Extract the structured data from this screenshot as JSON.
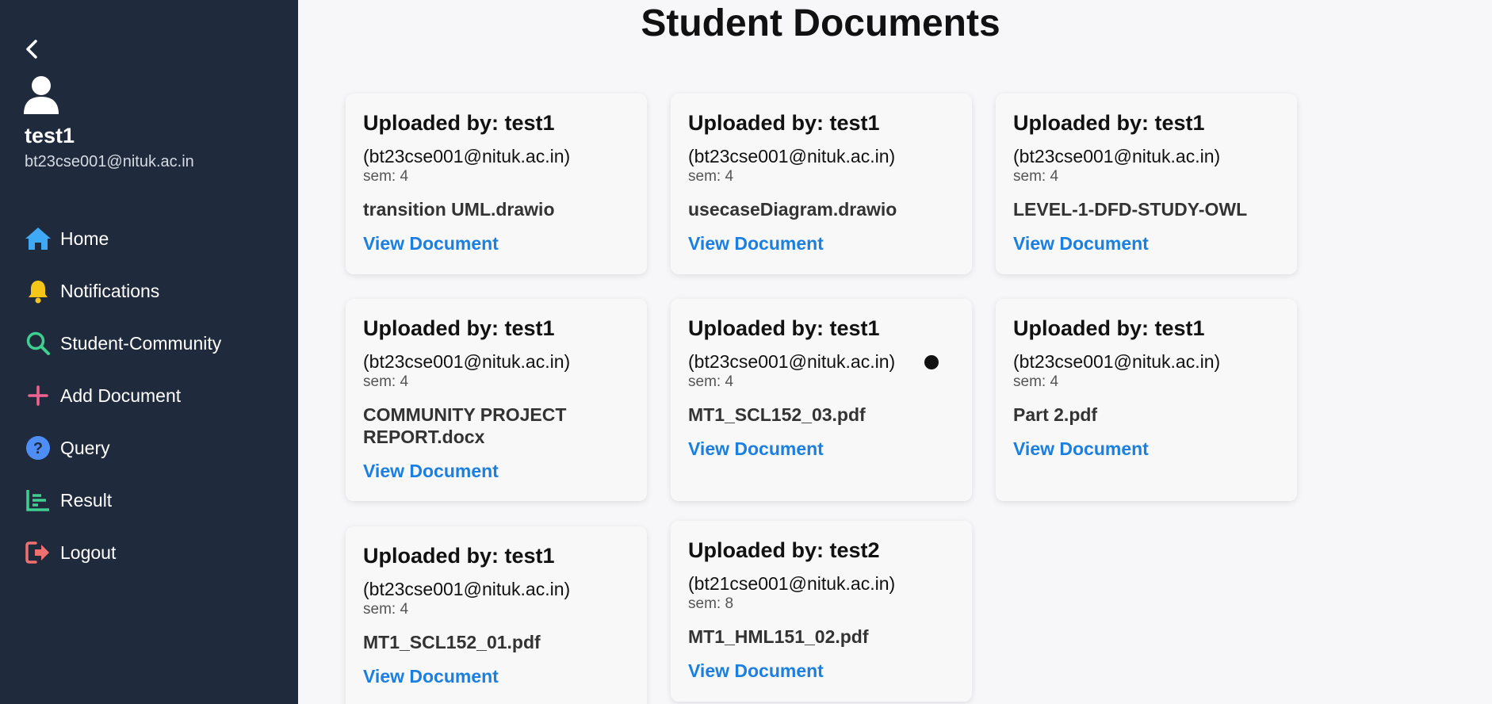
{
  "sidebar": {
    "user_name": "test1",
    "user_email": "bt23cse001@nituk.ac.in",
    "items": [
      {
        "label": "Home",
        "icon": "home-icon",
        "color": "#3fa9f5"
      },
      {
        "label": "Notifications",
        "icon": "bell-icon",
        "color": "#f5c518"
      },
      {
        "label": "Student-Community",
        "icon": "search-icon",
        "color": "#3fd08f"
      },
      {
        "label": "Add Document",
        "icon": "plus-icon",
        "color": "#f06292"
      },
      {
        "label": "Query",
        "icon": "question-icon",
        "color": "#4f8ef7"
      },
      {
        "label": "Result",
        "icon": "chart-icon",
        "color": "#3fd08f"
      },
      {
        "label": "Logout",
        "icon": "logout-icon",
        "color": "#f07070"
      }
    ]
  },
  "main": {
    "title": "Student Documents",
    "link_color": "#1a7fe0",
    "cards": [
      {
        "uploader": "Uploaded by: test1",
        "email": "(bt23cse001@nituk.ac.in)",
        "sem": "sem: 4",
        "file": "transition UML.drawio",
        "link": "View Document"
      },
      {
        "uploader": "Uploaded by: test1",
        "email": "(bt23cse001@nituk.ac.in)",
        "sem": "sem: 4",
        "file": "usecaseDiagram.drawio",
        "link": "View Document"
      },
      {
        "uploader": "Uploaded by: test1",
        "email": "(bt23cse001@nituk.ac.in)",
        "sem": "sem: 4",
        "file": "LEVEL-1-DFD-STUDY-OWL",
        "link": "View Document"
      },
      {
        "uploader": "Uploaded by: test1",
        "email": "(bt23cse001@nituk.ac.in)",
        "sem": "sem: 4",
        "file": "COMMUNITY PROJECT REPORT.docx",
        "link": "View Document"
      },
      {
        "uploader": "Uploaded by: test1",
        "email": "(bt23cse001@nituk.ac.in)",
        "sem": "sem: 4",
        "file": "MT1_SCL152_03.pdf",
        "link": "View Document"
      },
      {
        "uploader": "Uploaded by: test1",
        "email": "(bt23cse001@nituk.ac.in)",
        "sem": "sem: 4",
        "file": "Part 2.pdf",
        "link": "View Document"
      },
      {
        "uploader": "Uploaded by: test1",
        "email": "(bt23cse001@nituk.ac.in)",
        "sem": "sem: 4",
        "file": "MT1_SCL152_01.pdf",
        "link": "View Document"
      },
      {
        "uploader": "Uploaded by: test2",
        "email": "(bt21cse001@nituk.ac.in)",
        "sem": "sem: 8",
        "file": "MT1_HML151_02.pdf",
        "link": "View Document"
      }
    ]
  }
}
